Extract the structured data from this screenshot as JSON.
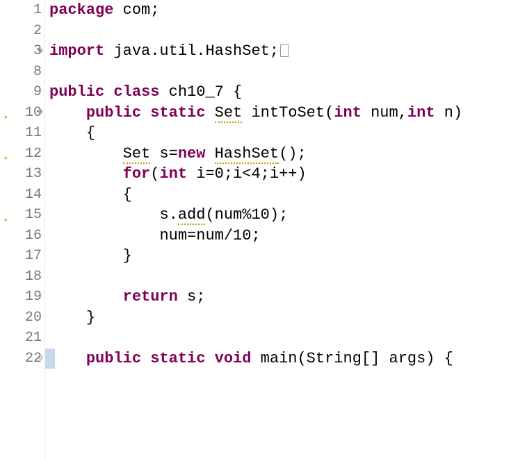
{
  "lines": [
    {
      "num": "1",
      "marker": "",
      "fold": "",
      "indent": "",
      "tokens": [
        {
          "t": "package",
          "cls": "kw"
        },
        {
          "t": " com;",
          "cls": "plain"
        }
      ]
    },
    {
      "num": "2",
      "marker": "",
      "fold": "",
      "indent": "",
      "tokens": []
    },
    {
      "num": "3",
      "marker": "",
      "fold": "⊕",
      "indent": "",
      "tokens": [
        {
          "t": "import",
          "cls": "kw"
        },
        {
          "t": " java.util.HashSet;",
          "cls": "plain"
        }
      ],
      "trailing_box": true
    },
    {
      "num": "8",
      "marker": "",
      "fold": "",
      "indent": "",
      "tokens": []
    },
    {
      "num": "9",
      "marker": "",
      "fold": "",
      "indent": "",
      "tokens": [
        {
          "t": "public",
          "cls": "kw"
        },
        {
          "t": " ",
          "cls": ""
        },
        {
          "t": "class",
          "cls": "kw"
        },
        {
          "t": " ch10_7 {",
          "cls": "plain"
        }
      ]
    },
    {
      "num": "10",
      "marker": "⚠",
      "fold": "⊖",
      "indent": "    ",
      "tokens": [
        {
          "t": "public",
          "cls": "kw"
        },
        {
          "t": " ",
          "cls": ""
        },
        {
          "t": "static",
          "cls": "kw"
        },
        {
          "t": " ",
          "cls": ""
        },
        {
          "t": "Set",
          "cls": "warn-underline"
        },
        {
          "t": " intToSet(",
          "cls": "plain"
        },
        {
          "t": "int",
          "cls": "kw"
        },
        {
          "t": " num,",
          "cls": "plain"
        },
        {
          "t": "int",
          "cls": "kw"
        },
        {
          "t": " n)",
          "cls": "plain"
        }
      ]
    },
    {
      "num": "11",
      "marker": "",
      "fold": "",
      "indent": "    ",
      "tokens": [
        {
          "t": "{",
          "cls": "plain"
        }
      ]
    },
    {
      "num": "12",
      "marker": "⚠",
      "fold": "",
      "indent": "        ",
      "tokens": [
        {
          "t": "Set",
          "cls": "warn-underline"
        },
        {
          "t": " s=",
          "cls": "plain"
        },
        {
          "t": "new",
          "cls": "kw"
        },
        {
          "t": " ",
          "cls": ""
        },
        {
          "t": "HashSet",
          "cls": "warn-underline"
        },
        {
          "t": "();",
          "cls": "plain"
        }
      ]
    },
    {
      "num": "13",
      "marker": "",
      "fold": "",
      "indent": "        ",
      "tokens": [
        {
          "t": "for",
          "cls": "kw"
        },
        {
          "t": "(",
          "cls": "plain"
        },
        {
          "t": "int",
          "cls": "kw"
        },
        {
          "t": " i=0;i<4;i++)",
          "cls": "plain"
        }
      ]
    },
    {
      "num": "14",
      "marker": "",
      "fold": "",
      "indent": "        ",
      "tokens": [
        {
          "t": "{",
          "cls": "plain"
        }
      ]
    },
    {
      "num": "15",
      "marker": "⚠",
      "fold": "",
      "indent": "            ",
      "tokens": [
        {
          "t": "s.",
          "cls": "plain"
        },
        {
          "t": "add",
          "cls": "warn-underline"
        },
        {
          "t": "(num%10);",
          "cls": "plain"
        }
      ]
    },
    {
      "num": "16",
      "marker": "",
      "fold": "",
      "indent": "            ",
      "tokens": [
        {
          "t": "num=num/10;",
          "cls": "plain"
        }
      ]
    },
    {
      "num": "17",
      "marker": "",
      "fold": "",
      "indent": "        ",
      "tokens": [
        {
          "t": "}",
          "cls": "plain"
        }
      ]
    },
    {
      "num": "18",
      "marker": "",
      "fold": "",
      "indent": "",
      "tokens": []
    },
    {
      "num": "19",
      "marker": "",
      "fold": "",
      "indent": "        ",
      "tokens": [
        {
          "t": "return",
          "cls": "kw"
        },
        {
          "t": " s;",
          "cls": "plain"
        }
      ]
    },
    {
      "num": "20",
      "marker": "",
      "fold": "",
      "indent": "    ",
      "tokens": [
        {
          "t": "}",
          "cls": "plain"
        }
      ]
    },
    {
      "num": "21",
      "marker": "",
      "fold": "",
      "indent": "",
      "tokens": []
    },
    {
      "num": "22",
      "marker": "",
      "fold": "⊖",
      "indent": "    ",
      "tokens": [
        {
          "t": "public",
          "cls": "kw"
        },
        {
          "t": " ",
          "cls": ""
        },
        {
          "t": "static",
          "cls": "kw"
        },
        {
          "t": " ",
          "cls": ""
        },
        {
          "t": "void",
          "cls": "kw"
        },
        {
          "t": " main(String[] args) {",
          "cls": "plain"
        }
      ],
      "highlight_first": true
    }
  ]
}
